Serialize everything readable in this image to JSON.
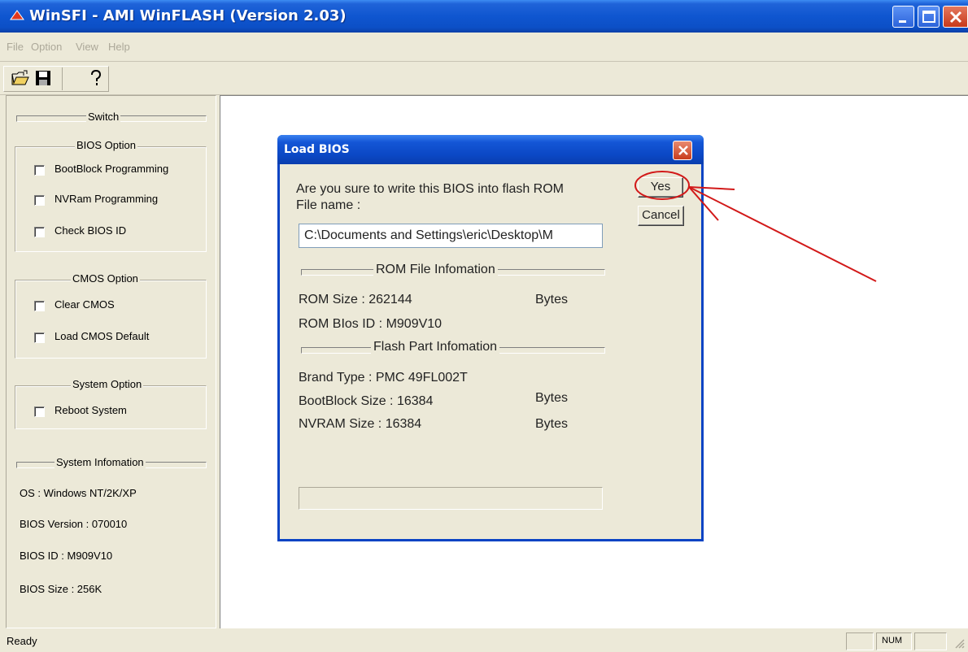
{
  "window": {
    "title": "WinSFI - AMI WinFLASH (Version 2.03)"
  },
  "menu": [
    "File",
    "Option",
    "View",
    "Help"
  ],
  "toolbar": {
    "buttons": [
      "open-icon",
      "save-icon",
      "help-icon"
    ]
  },
  "left_panel": {
    "switch_label": "Switch",
    "bios_option": {
      "label": "BIOS Option",
      "items": [
        "BootBlock Programming",
        "NVRam Programming",
        "Check BIOS ID"
      ]
    },
    "cmos_option": {
      "label": "CMOS Option",
      "items": [
        "Clear CMOS",
        "Load CMOS Default"
      ]
    },
    "system_option": {
      "label": "System Option",
      "items": [
        "Reboot System"
      ]
    },
    "system_info": {
      "label": "System Infomation",
      "os": "OS :  Windows NT/2K/XP",
      "bios_version": "BIOS Version :  070010",
      "bios_id": "BIOS ID :    M909V10",
      "bios_size": "BIOS Size :   256K"
    }
  },
  "status": {
    "text": "Ready",
    "num": "NUM"
  },
  "dialog": {
    "title": "Load BIOS",
    "question": "Are you sure to write this BIOS into flash ROM",
    "file_name_label": "File name :",
    "file_name_value": "C:\\Documents and Settings\\eric\\Desktop\\M",
    "yes_label": "Yes",
    "cancel_label": "Cancel",
    "rom_section": "ROM File Infomation",
    "rom_size_label": "ROM Size :  262144",
    "rom_size_unit": "Bytes",
    "rom_bios_id": "ROM BIos ID  :  M909V10",
    "flash_section": "Flash Part Infomation",
    "brand_type": "Brand Type :    PMC 49FL002T",
    "bootblock_size": "BootBlock Size :  16384",
    "bootblock_unit": "Bytes",
    "nvram_size": "NVRAM Size :    16384",
    "nvram_unit": "Bytes",
    "progress": 0
  },
  "colors": {
    "titlebar": "#0c4fc6",
    "face": "#ece9d8",
    "annotation": "#d21919"
  }
}
